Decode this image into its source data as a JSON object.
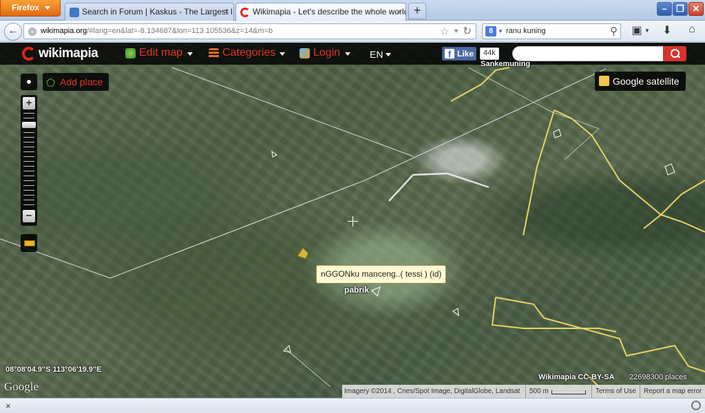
{
  "browser": {
    "app_button": "Firefox",
    "tabs": [
      {
        "title": "Search in Forum | Kaskus - The Largest I...",
        "active": false
      },
      {
        "title": "Wikimapia - Let's describe the whole world!",
        "active": true
      }
    ],
    "new_tab": "+",
    "url_domain": "wikimapia.org",
    "url_path": "/#lang=en&lat=-8.134687&lon=113.105536&z=14&m=b",
    "search_query": "ranu kuning",
    "search_engine_glyph": "8",
    "window_controls": {
      "minimize": "–",
      "restore": "❐",
      "close": "✕"
    }
  },
  "wikimapia": {
    "logo_text": "wikimapia",
    "menu": {
      "edit_map": "Edit map",
      "categories": "Categories",
      "login": "Login",
      "language": "EN"
    },
    "facebook": {
      "like_label": "Like",
      "count": "44k"
    },
    "search_placeholder": "",
    "add_place": "Add place",
    "map_type": "Google satellite",
    "tooltip": "nGGONku manceng..( tessi ) (id)",
    "place_labels": [
      "pabrik",
      "Sankemuning"
    ],
    "coordinates": "08°08'04.9\"S 113°06'19.9\"E",
    "google_logo": "Google",
    "license": "Wikimapia CC-BY-SA",
    "place_count": "22698300 places",
    "attribution": "Imagery ©2014 , Cnes/Spot Image, DigitalGlobe, Landsat",
    "scale": "500 m",
    "terms": "Terms of Use",
    "report": "Report a map error",
    "zoom": {
      "in": "+",
      "out": "−",
      "level": 14
    }
  },
  "status": {
    "close": "×"
  },
  "colors": {
    "wikimapia_red": "#e0352b",
    "boundary_yellow": "#e8d566",
    "road_white": "#dde3e8",
    "firefox_orange": "#e8741a"
  },
  "icons": {
    "back": "back-arrow-icon",
    "bookmark": "star-icon",
    "reload": "reload-icon",
    "home": "home-icon",
    "downloads": "download-icon"
  }
}
